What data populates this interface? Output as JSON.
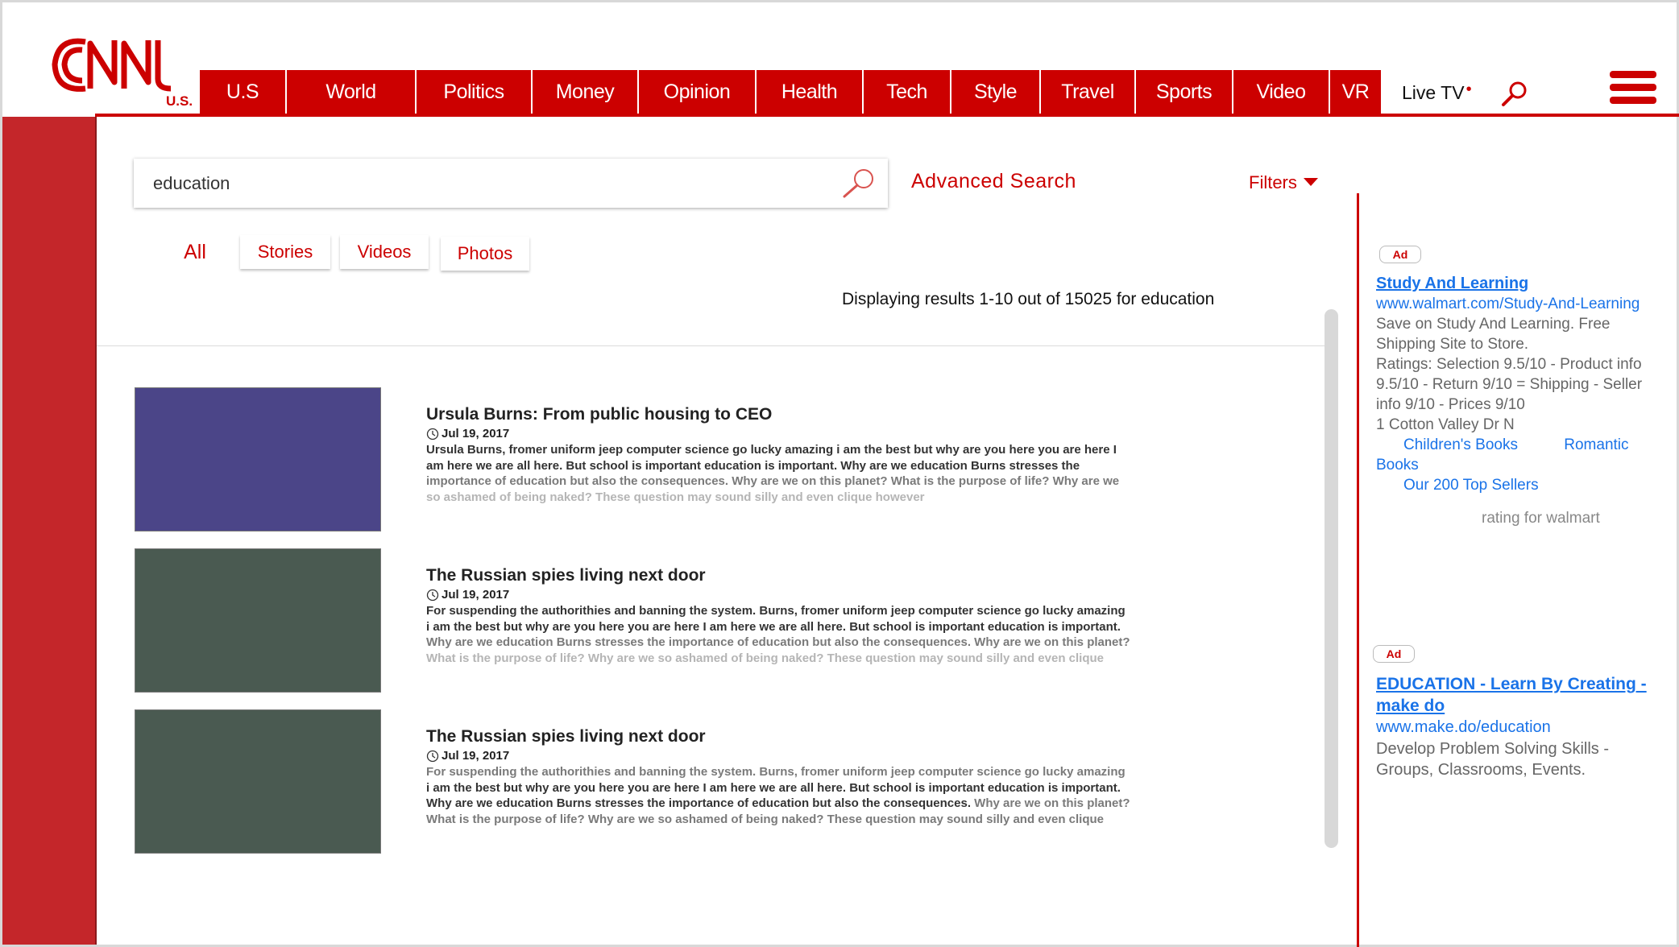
{
  "header": {
    "logo_text": "CNN",
    "edition": "U.S.",
    "nav": [
      "U.S",
      "World",
      "Politics",
      "Money",
      "Opinion",
      "Health",
      "Tech",
      "Style",
      "Travel",
      "Sports",
      "Video",
      "VR"
    ],
    "live_tv": "Live TV",
    "live_dot": "•"
  },
  "search": {
    "query": "education",
    "advanced_label": "Advanced Search",
    "filters_label": "Filters"
  },
  "tabs": [
    "All",
    "Stories",
    "Videos",
    "Photos"
  ],
  "results_summary": "Displaying results 1-10 out of 15025 for education",
  "results": [
    {
      "title": "Ursula Burns: From public housing to CEO",
      "date": "Jul 19, 2017",
      "thumb_color": "#4b4588",
      "lines": [
        {
          "text": "Ursula Burns, fromer uniform jeep computer science go lucky amazing i am the best but why are you here you are here I",
          "shade": "dark"
        },
        {
          "text": "am here we are all here. But school is important education is important. Why are we education Burns stresses the",
          "shade": "dark"
        },
        {
          "text": "importance of education but also the consequences. Why are we on this planet? What is the purpose of life? Why are we",
          "shade": "mid"
        },
        {
          "text": "so ashamed of being naked? These question may sound silly and even clique however",
          "shade": "light"
        }
      ]
    },
    {
      "title": "The Russian spies living next door",
      "date": "Jul 19, 2017",
      "thumb_color": "#4a5a51",
      "lines": [
        {
          "text": "For suspending the authorithies and banning the system.  Burns, fromer uniform jeep computer science go lucky amazing",
          "shade": "dark"
        },
        {
          "text": "i am the best but why are you here you are here I am here we are all here. But school is important education is important.",
          "shade": "dark"
        },
        {
          "text": "Why are we education Burns stresses the importance of education but also the consequences. Why are we on this planet?",
          "shade": "mid"
        },
        {
          "text": "What is the purpose of life? Why are we so ashamed of being naked? These question may sound silly and even clique",
          "shade": "light"
        }
      ]
    },
    {
      "title": "The Russian spies living next door",
      "date": "Jul 19, 2017",
      "thumb_color": "#4a5a51",
      "lines": [
        {
          "text": "For suspending the authorithies and banning the system.  Burns, fromer uniform jeep computer science go lucky amazing",
          "shade": "mid"
        },
        {
          "text": "i am the best but why are you here you are here I am here we are all here. But school is important education is important.",
          "shade": "dark"
        },
        {
          "text": "Why are we education Burns stresses the importance of education but also the consequences.",
          "shade": "dark",
          "tail": " Why are we on this planet?"
        },
        {
          "text": "What is the purpose of life? Why are we so ashamed of being naked? These question may sound silly and even clique",
          "shade": "mid"
        }
      ]
    }
  ],
  "ads": [
    {
      "badge": "Ad",
      "title": "Study And Learning",
      "url": "www.walmart.com/Study-And-Learning",
      "description": "Save on Study And Learning. Free Shipping Site to Store.",
      "ratings": "Ratings: Selection 9.5/10 - Product info 9.5/10 - Return 9/10 = Shipping - Seller info 9/10 - Prices 9/10",
      "address": "1 Cotton Valley Dr N",
      "sitelinks": [
        "Children's Books",
        "Romantic Books",
        "Our 200 Top Sellers"
      ],
      "rating_note": "rating for walmart"
    },
    {
      "badge": "Ad",
      "title": "EDUCATION - Learn By Creating - make do",
      "url": "www.make.do/education",
      "description": "Develop Problem Solving Skills - Groups, Classrooms, Events."
    }
  ],
  "colors": {
    "brand_red": "#cc0000",
    "sidebar_red": "#c4262a",
    "ad_link_blue": "#1a73e8"
  },
  "icons": [
    "search-icon",
    "clock-icon",
    "hamburger-menu-icon",
    "chevron-down-icon"
  ]
}
